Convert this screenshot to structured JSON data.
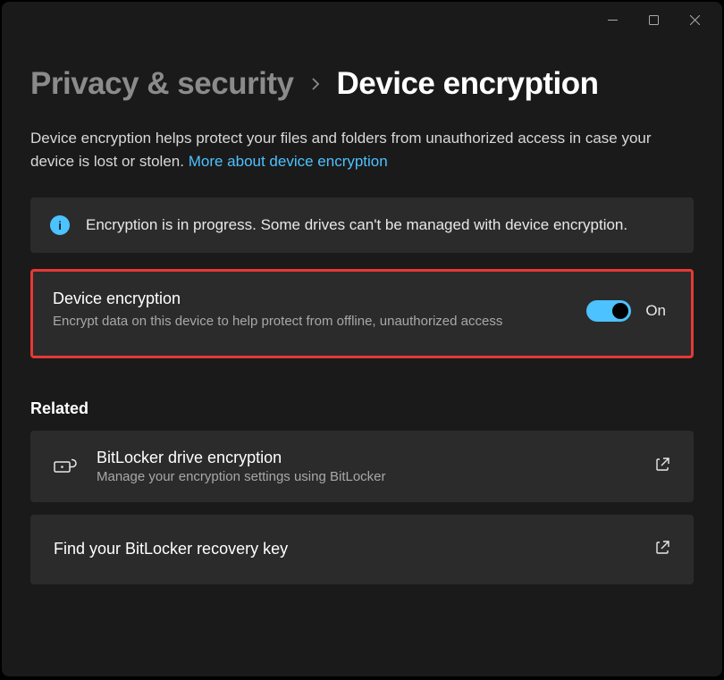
{
  "breadcrumb": {
    "parent": "Privacy & security",
    "current": "Device encryption"
  },
  "description": {
    "text": "Device encryption helps protect your files and folders from unauthorized access in case your device is lost or stolen. ",
    "link": "More about device encryption"
  },
  "info": {
    "message": "Encryption is in progress. Some drives can't be managed with device encryption."
  },
  "toggle": {
    "title": "Device encryption",
    "description": "Encrypt data on this device to help protect from offline, unauthorized access",
    "state_label": "On"
  },
  "related": {
    "heading": "Related",
    "items": [
      {
        "title": "BitLocker drive encryption",
        "description": "Manage your encryption settings using BitLocker"
      },
      {
        "title": "Find your BitLocker recovery key"
      }
    ]
  }
}
